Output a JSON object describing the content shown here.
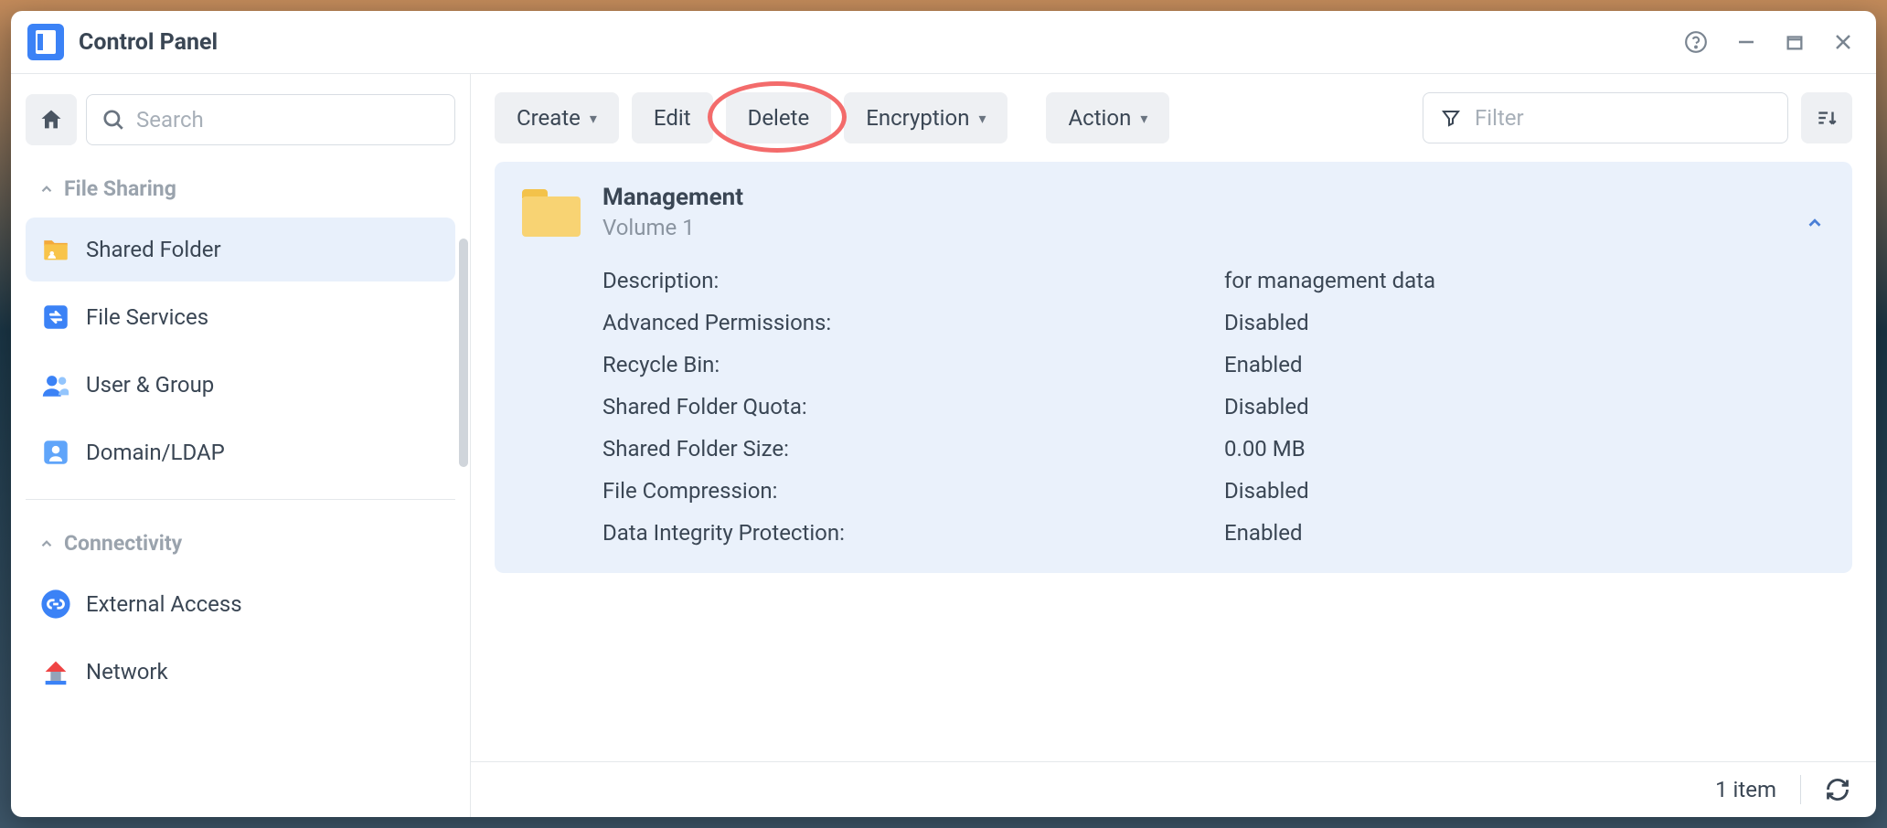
{
  "window": {
    "title": "Control Panel"
  },
  "sidebar": {
    "search_placeholder": "Search",
    "sections": [
      {
        "label": "File Sharing"
      },
      {
        "label": "Connectivity"
      }
    ],
    "items": {
      "shared_folder": "Shared Folder",
      "file_services": "File Services",
      "user_group": "User & Group",
      "domain_ldap": "Domain/LDAP",
      "external_access": "External Access",
      "network": "Network"
    }
  },
  "toolbar": {
    "create": "Create",
    "edit": "Edit",
    "delete": "Delete",
    "encryption": "Encryption",
    "action": "Action",
    "filter_placeholder": "Filter"
  },
  "folder": {
    "name": "Management",
    "volume": "Volume 1",
    "labels": {
      "description": "Description:",
      "adv_perm": "Advanced Permissions:",
      "recycle": "Recycle Bin:",
      "quota": "Shared Folder Quota:",
      "size": "Shared Folder Size:",
      "compression": "File Compression:",
      "integrity": "Data Integrity Protection:"
    },
    "values": {
      "description": "for management data",
      "adv_perm": "Disabled",
      "recycle": "Enabled",
      "quota": "Disabled",
      "size": "0.00 MB",
      "compression": "Disabled",
      "integrity": "Enabled"
    }
  },
  "status": {
    "count": "1 item"
  }
}
